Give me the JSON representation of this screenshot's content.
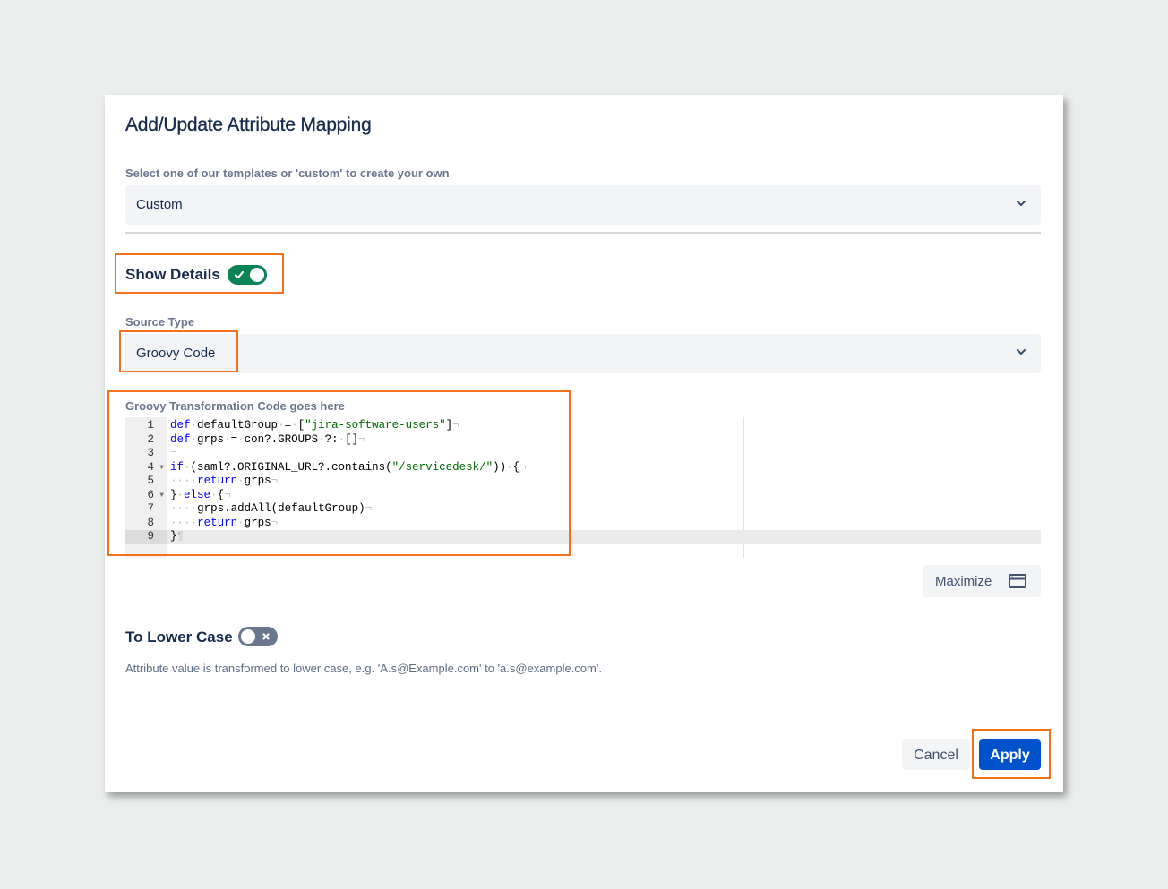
{
  "dialog": {
    "title": "Add/Update Attribute Mapping",
    "template_select": {
      "label": "Select one of our templates or 'custom' to create your own",
      "value": "Custom"
    },
    "show_details": {
      "label": "Show Details",
      "enabled": true
    },
    "source_type": {
      "label": "Source Type",
      "value": "Groovy Code"
    },
    "code_editor": {
      "label": "Groovy Transformation Code goes here",
      "active_line": 9,
      "lines": [
        {
          "n": "1",
          "text": "def defaultGroup = [\"jira-software-users\"]"
        },
        {
          "n": "2",
          "text": "def grps = con?.GROUPS ?: []"
        },
        {
          "n": "3",
          "text": ""
        },
        {
          "n": "4",
          "text": "if (saml?.ORIGINAL_URL?.contains(\"/servicedesk/\")) {",
          "fold": true
        },
        {
          "n": "5",
          "text": "    return grps"
        },
        {
          "n": "6",
          "text": "} else {",
          "fold": true
        },
        {
          "n": "7",
          "text": "    grps.addAll(defaultGroup)"
        },
        {
          "n": "8",
          "text": "    return grps"
        },
        {
          "n": "9",
          "text": "}"
        }
      ],
      "maximize_label": "Maximize"
    },
    "to_lower_case": {
      "label": "To Lower Case",
      "enabled": false,
      "help": "Attribute value is transformed to lower case, e.g. 'A.s@Example.com' to 'a.s@example.com'."
    },
    "buttons": {
      "cancel": "Cancel",
      "apply": "Apply"
    }
  },
  "colors": {
    "primary": "#0052cc",
    "toggle_on": "#0a8457",
    "toggle_off": "#6b778c",
    "highlight": "#f2711c"
  }
}
